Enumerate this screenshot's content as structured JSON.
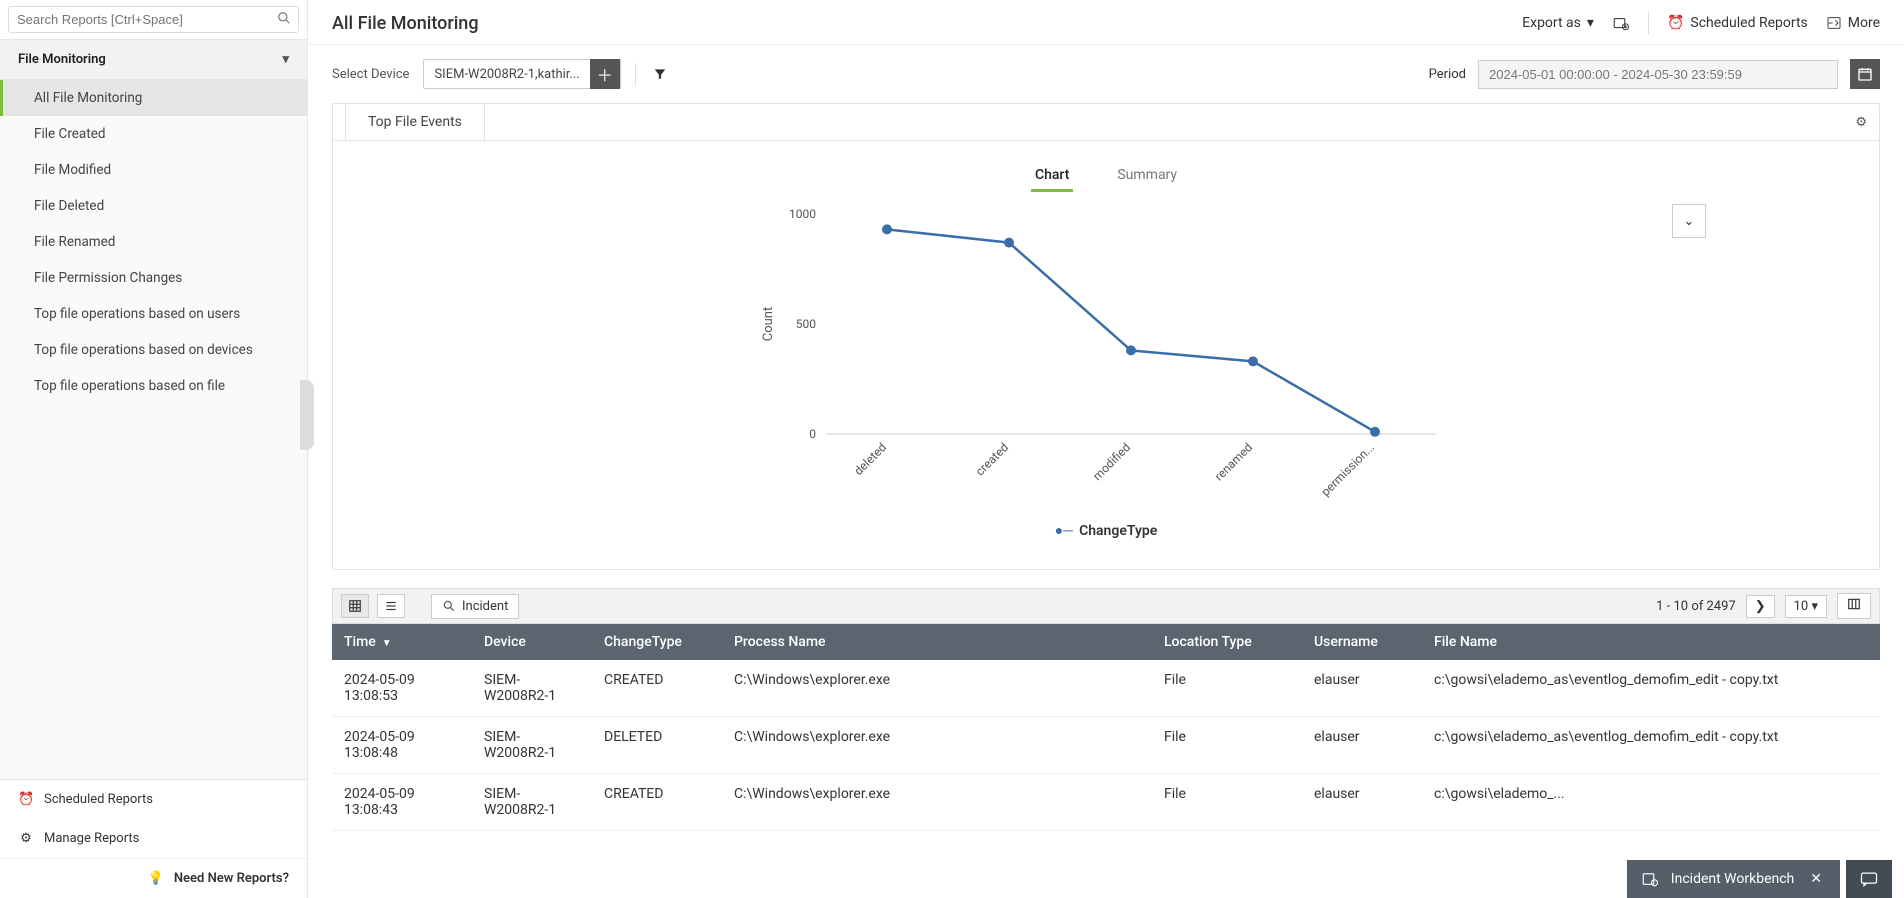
{
  "search": {
    "placeholder": "Search Reports [Ctrl+Space]"
  },
  "sidebar": {
    "section": "File Monitoring",
    "items": [
      "All File Monitoring",
      "File Created",
      "File Modified",
      "File Deleted",
      "File Renamed",
      "File Permission Changes",
      "Top file operations based on users",
      "Top file operations based on devices",
      "Top file operations based on file"
    ],
    "footer": {
      "scheduled": "Scheduled Reports",
      "manage": "Manage Reports",
      "need": "Need New Reports?"
    }
  },
  "header": {
    "title": "All File Monitoring",
    "export": "Export as",
    "scheduled": "Scheduled Reports",
    "more": "More"
  },
  "controls": {
    "select_device": "Select Device",
    "device_value": "SIEM-W2008R2-1,kathir...",
    "period_label": "Period",
    "period_value": "2024-05-01 00:00:00 - 2024-05-30 23:59:59"
  },
  "chart_card": {
    "tab": "Top File Events",
    "mode_chart": "Chart",
    "mode_summary": "Summary",
    "legend": "ChangeType"
  },
  "chart_data": {
    "type": "line",
    "categories": [
      "deleted",
      "created",
      "modified",
      "renamed",
      "permission..."
    ],
    "values": [
      930,
      870,
      380,
      330,
      10
    ],
    "xlabel": "",
    "ylabel": "Count",
    "ylim": [
      0,
      1000
    ],
    "yticks": [
      0,
      500,
      1000
    ],
    "series_name": "ChangeType"
  },
  "table": {
    "toolbar": {
      "incident": "Incident",
      "range": "1 - 10 of 2497",
      "page_size": "10"
    },
    "columns": [
      "Time",
      "Device",
      "ChangeType",
      "Process Name",
      "Location Type",
      "Username",
      "File Name"
    ],
    "rows": [
      {
        "time": "2024-05-09 13:08:53",
        "device": "SIEM-W2008R2-1",
        "change": "CREATED",
        "proc": "C:\\Windows\\explorer.exe",
        "loc": "File",
        "user": "elauser",
        "file": "c:\\gowsi\\elademo_as\\eventlog_demofim_edit - copy.txt"
      },
      {
        "time": "2024-05-09 13:08:48",
        "device": "SIEM-W2008R2-1",
        "change": "DELETED",
        "proc": "C:\\Windows\\explorer.exe",
        "loc": "File",
        "user": "elauser",
        "file": "c:\\gowsi\\elademo_as\\eventlog_demofim_edit - copy.txt"
      },
      {
        "time": "2024-05-09 13:08:43",
        "device": "SIEM-W2008R2-1",
        "change": "CREATED",
        "proc": "C:\\Windows\\explorer.exe",
        "loc": "File",
        "user": "elauser",
        "file": "c:\\gowsi\\elademo_..."
      }
    ]
  },
  "workbench": {
    "title": "Incident Workbench"
  }
}
